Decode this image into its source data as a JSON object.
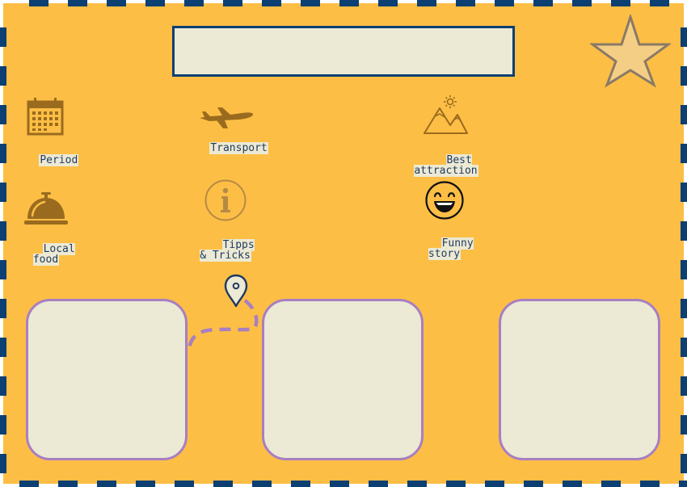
{
  "colors": {
    "background": "#FDBE45",
    "border_dash": "#0C3F72",
    "panel": "#ECE9D4",
    "icon_brown": "#9A6B1E",
    "photo_border": "#A77FC2",
    "star_fill": "#F5CE85",
    "star_stroke": "#8A7A66"
  },
  "title": "",
  "categories": [
    {
      "id": "period",
      "icon": "calendar-icon",
      "label": "Period"
    },
    {
      "id": "transport",
      "icon": "airplane-icon",
      "label": "Transport"
    },
    {
      "id": "attraction",
      "icon": "mountain-sun-icon",
      "label": "Best\nattraction"
    },
    {
      "id": "food",
      "icon": "cloche-icon",
      "label": "Local\nfood"
    },
    {
      "id": "tips",
      "icon": "info-icon",
      "label": "Tipps\n& Tricks"
    },
    {
      "id": "story",
      "icon": "smiley-icon",
      "label": "Funny\nstory"
    }
  ],
  "photos": [
    {
      "id": "photo-1"
    },
    {
      "id": "photo-2"
    },
    {
      "id": "photo-3"
    }
  ]
}
